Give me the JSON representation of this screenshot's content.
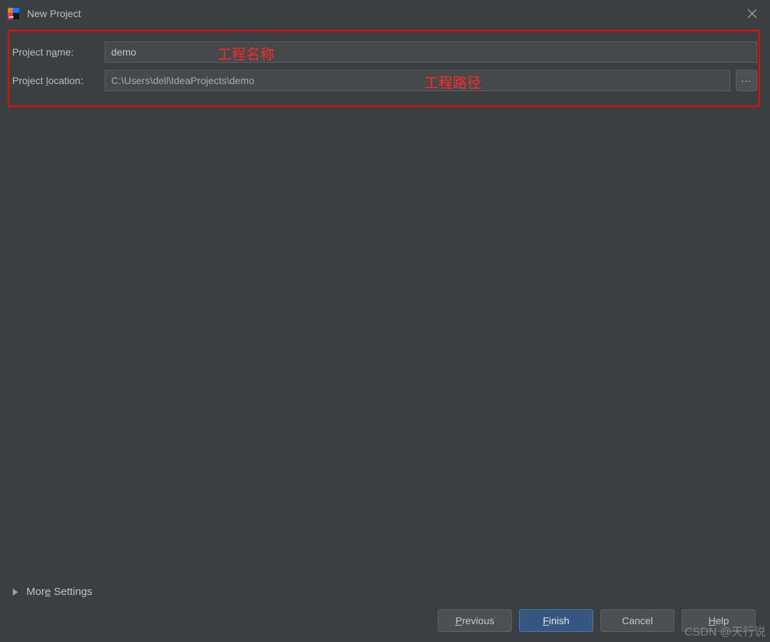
{
  "window": {
    "title": "New Project"
  },
  "form": {
    "name_label_pre": "Project n",
    "name_label_u": "a",
    "name_label_post": "me:",
    "name_value": "demo",
    "location_label_pre": "Project ",
    "location_label_u": "l",
    "location_label_post": "ocation:",
    "location_value": "C:\\Users\\dell\\IdeaProjects\\demo",
    "browse": "..."
  },
  "annotations": {
    "name": "工程名称",
    "path": "工程路径"
  },
  "more": {
    "pre": "Mor",
    "u": "e",
    "post": " Settings"
  },
  "buttons": {
    "previous_u": "P",
    "previous_post": "revious",
    "finish_u": "F",
    "finish_post": "inish",
    "cancel": "Cancel",
    "help_u": "H",
    "help_post": "elp"
  },
  "watermark": "CSDN @天行说"
}
